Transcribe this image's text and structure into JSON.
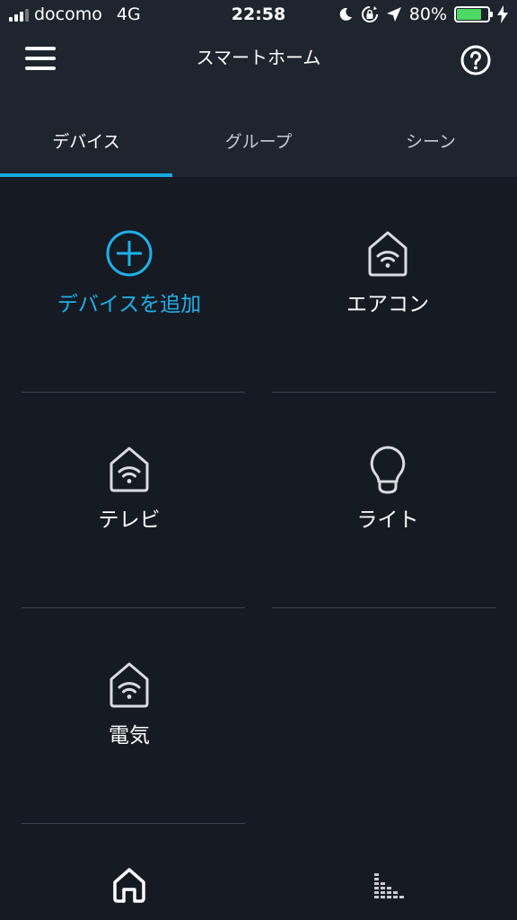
{
  "status_bar": {
    "carrier": "docomo",
    "network": "4G",
    "time": "22:58",
    "battery": "80%",
    "battery_level": 0.8,
    "icons": [
      "moon-icon",
      "rotation-lock-icon",
      "location-arrow-icon",
      "charging-bolt-icon"
    ]
  },
  "header": {
    "title": "スマートホーム",
    "menu_icon": "hamburger-menu-icon",
    "help_icon": "help-circle-icon"
  },
  "tabs": [
    {
      "label": "デバイス",
      "active": true
    },
    {
      "label": "グループ",
      "active": false
    },
    {
      "label": "シーン",
      "active": false
    }
  ],
  "devices": [
    {
      "label": "デバイスを追加",
      "icon": "add-circle-icon",
      "accent": true
    },
    {
      "label": "エアコン",
      "icon": "smart-home-wifi-icon"
    },
    {
      "label": "テレビ",
      "icon": "smart-home-wifi-icon"
    },
    {
      "label": "ライト",
      "icon": "light-bulb-icon"
    },
    {
      "label": "電気",
      "icon": "smart-home-wifi-icon"
    }
  ],
  "bottom_nav": [
    {
      "icon": "home-icon",
      "active": true
    },
    {
      "icon": "equalizer-bars-icon",
      "active": false
    }
  ],
  "colors": {
    "background": "#161b23",
    "header": "#1f252e",
    "accent": "#1fb1ea",
    "battery": "#4cd964"
  }
}
